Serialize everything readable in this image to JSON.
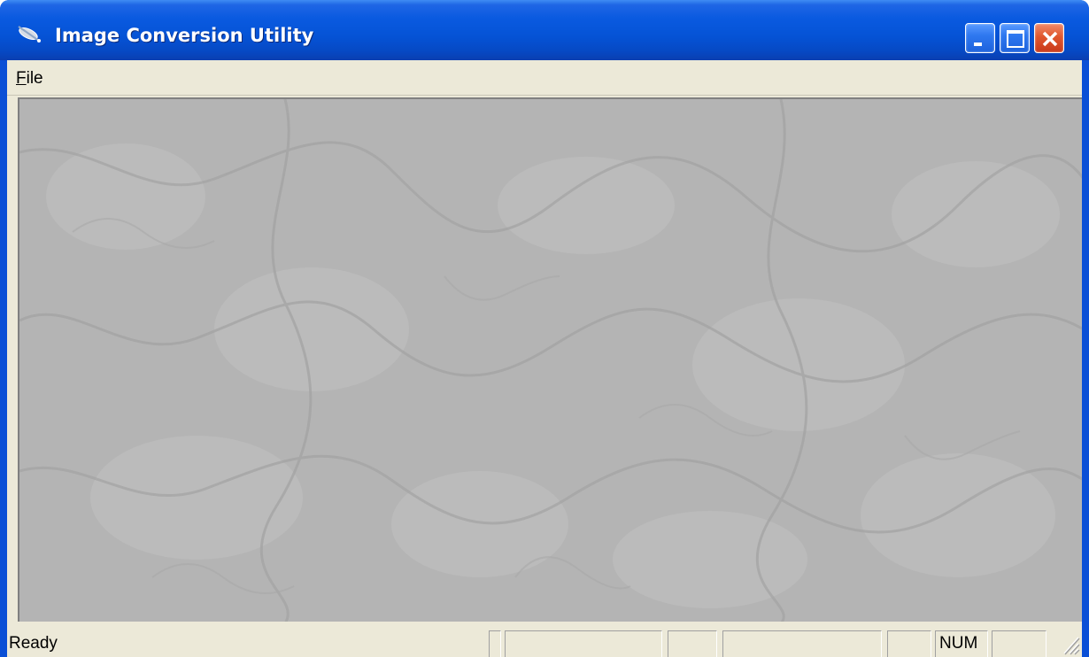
{
  "window": {
    "title": "Image Conversion Utility",
    "title_color": "#0553d6",
    "controls": [
      "minimize-icon",
      "maximize-icon",
      "close-icon"
    ]
  },
  "menu": {
    "items": [
      {
        "label": "ile",
        "mnemonic": "F"
      }
    ]
  },
  "workspace": {
    "background": "#b3b3b3"
  },
  "status": {
    "text": "Ready",
    "panes": [
      "",
      "",
      "",
      "",
      "",
      "NUM",
      ""
    ]
  }
}
